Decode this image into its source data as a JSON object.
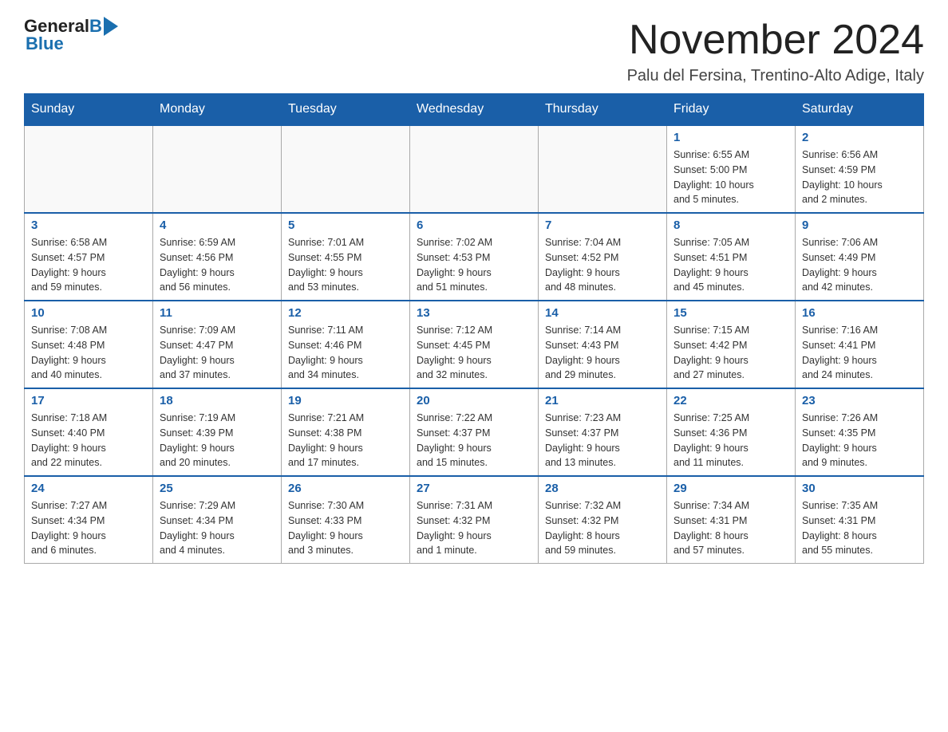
{
  "header": {
    "logo_general": "General",
    "logo_blue": "Blue",
    "title": "November 2024",
    "subtitle": "Palu del Fersina, Trentino-Alto Adige, Italy"
  },
  "days_of_week": [
    "Sunday",
    "Monday",
    "Tuesday",
    "Wednesday",
    "Thursday",
    "Friday",
    "Saturday"
  ],
  "weeks": [
    [
      {
        "day": "",
        "info": ""
      },
      {
        "day": "",
        "info": ""
      },
      {
        "day": "",
        "info": ""
      },
      {
        "day": "",
        "info": ""
      },
      {
        "day": "",
        "info": ""
      },
      {
        "day": "1",
        "info": "Sunrise: 6:55 AM\nSunset: 5:00 PM\nDaylight: 10 hours\nand 5 minutes."
      },
      {
        "day": "2",
        "info": "Sunrise: 6:56 AM\nSunset: 4:59 PM\nDaylight: 10 hours\nand 2 minutes."
      }
    ],
    [
      {
        "day": "3",
        "info": "Sunrise: 6:58 AM\nSunset: 4:57 PM\nDaylight: 9 hours\nand 59 minutes."
      },
      {
        "day": "4",
        "info": "Sunrise: 6:59 AM\nSunset: 4:56 PM\nDaylight: 9 hours\nand 56 minutes."
      },
      {
        "day": "5",
        "info": "Sunrise: 7:01 AM\nSunset: 4:55 PM\nDaylight: 9 hours\nand 53 minutes."
      },
      {
        "day": "6",
        "info": "Sunrise: 7:02 AM\nSunset: 4:53 PM\nDaylight: 9 hours\nand 51 minutes."
      },
      {
        "day": "7",
        "info": "Sunrise: 7:04 AM\nSunset: 4:52 PM\nDaylight: 9 hours\nand 48 minutes."
      },
      {
        "day": "8",
        "info": "Sunrise: 7:05 AM\nSunset: 4:51 PM\nDaylight: 9 hours\nand 45 minutes."
      },
      {
        "day": "9",
        "info": "Sunrise: 7:06 AM\nSunset: 4:49 PM\nDaylight: 9 hours\nand 42 minutes."
      }
    ],
    [
      {
        "day": "10",
        "info": "Sunrise: 7:08 AM\nSunset: 4:48 PM\nDaylight: 9 hours\nand 40 minutes."
      },
      {
        "day": "11",
        "info": "Sunrise: 7:09 AM\nSunset: 4:47 PM\nDaylight: 9 hours\nand 37 minutes."
      },
      {
        "day": "12",
        "info": "Sunrise: 7:11 AM\nSunset: 4:46 PM\nDaylight: 9 hours\nand 34 minutes."
      },
      {
        "day": "13",
        "info": "Sunrise: 7:12 AM\nSunset: 4:45 PM\nDaylight: 9 hours\nand 32 minutes."
      },
      {
        "day": "14",
        "info": "Sunrise: 7:14 AM\nSunset: 4:43 PM\nDaylight: 9 hours\nand 29 minutes."
      },
      {
        "day": "15",
        "info": "Sunrise: 7:15 AM\nSunset: 4:42 PM\nDaylight: 9 hours\nand 27 minutes."
      },
      {
        "day": "16",
        "info": "Sunrise: 7:16 AM\nSunset: 4:41 PM\nDaylight: 9 hours\nand 24 minutes."
      }
    ],
    [
      {
        "day": "17",
        "info": "Sunrise: 7:18 AM\nSunset: 4:40 PM\nDaylight: 9 hours\nand 22 minutes."
      },
      {
        "day": "18",
        "info": "Sunrise: 7:19 AM\nSunset: 4:39 PM\nDaylight: 9 hours\nand 20 minutes."
      },
      {
        "day": "19",
        "info": "Sunrise: 7:21 AM\nSunset: 4:38 PM\nDaylight: 9 hours\nand 17 minutes."
      },
      {
        "day": "20",
        "info": "Sunrise: 7:22 AM\nSunset: 4:37 PM\nDaylight: 9 hours\nand 15 minutes."
      },
      {
        "day": "21",
        "info": "Sunrise: 7:23 AM\nSunset: 4:37 PM\nDaylight: 9 hours\nand 13 minutes."
      },
      {
        "day": "22",
        "info": "Sunrise: 7:25 AM\nSunset: 4:36 PM\nDaylight: 9 hours\nand 11 minutes."
      },
      {
        "day": "23",
        "info": "Sunrise: 7:26 AM\nSunset: 4:35 PM\nDaylight: 9 hours\nand 9 minutes."
      }
    ],
    [
      {
        "day": "24",
        "info": "Sunrise: 7:27 AM\nSunset: 4:34 PM\nDaylight: 9 hours\nand 6 minutes."
      },
      {
        "day": "25",
        "info": "Sunrise: 7:29 AM\nSunset: 4:34 PM\nDaylight: 9 hours\nand 4 minutes."
      },
      {
        "day": "26",
        "info": "Sunrise: 7:30 AM\nSunset: 4:33 PM\nDaylight: 9 hours\nand 3 minutes."
      },
      {
        "day": "27",
        "info": "Sunrise: 7:31 AM\nSunset: 4:32 PM\nDaylight: 9 hours\nand 1 minute."
      },
      {
        "day": "28",
        "info": "Sunrise: 7:32 AM\nSunset: 4:32 PM\nDaylight: 8 hours\nand 59 minutes."
      },
      {
        "day": "29",
        "info": "Sunrise: 7:34 AM\nSunset: 4:31 PM\nDaylight: 8 hours\nand 57 minutes."
      },
      {
        "day": "30",
        "info": "Sunrise: 7:35 AM\nSunset: 4:31 PM\nDaylight: 8 hours\nand 55 minutes."
      }
    ]
  ]
}
